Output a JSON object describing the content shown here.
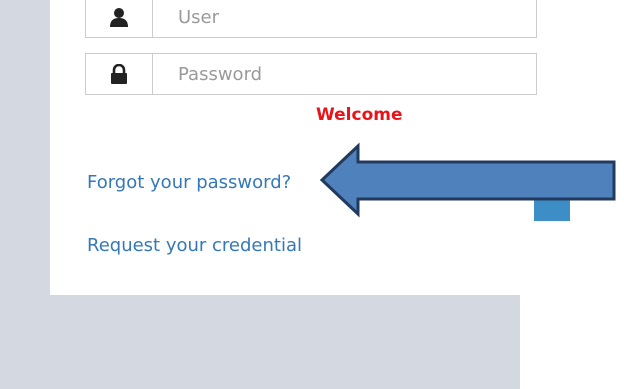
{
  "login": {
    "user_placeholder": "User",
    "password_placeholder": "Password",
    "welcome_text": "Welcome",
    "forgot_link": "Forgot your password?",
    "request_link": "Request your credential"
  },
  "icons": {
    "user": "user-icon",
    "password": "lock-icon",
    "annotation": "arrow-left-icon"
  },
  "colors": {
    "welcome": "#e8141a",
    "link": "#3478b8",
    "arrow_fill": "#4f81bd",
    "arrow_stroke": "#223a5e",
    "background": "#d4d8e1"
  }
}
